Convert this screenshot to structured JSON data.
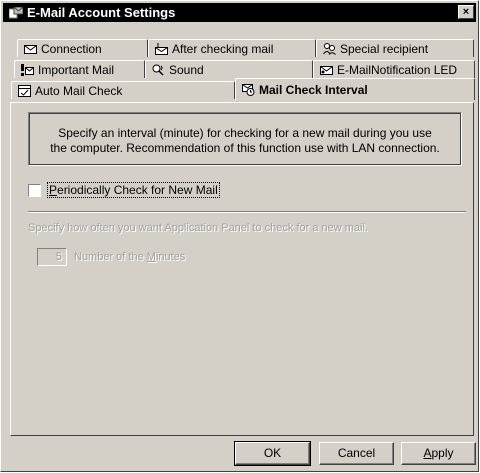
{
  "window": {
    "title": "E-Mail Account Settings",
    "close_glyph": "×"
  },
  "tabs": [
    {
      "label": "Connection",
      "icon": "envelope-icon"
    },
    {
      "label": "After checking mail",
      "icon": "mail-arrow-icon"
    },
    {
      "label": "Special recipient",
      "icon": "people-icon"
    },
    {
      "label": "Important Mail",
      "icon": "exclamation-mail-icon"
    },
    {
      "label": "Sound",
      "icon": "speaker-icon"
    },
    {
      "label": "E-MailNotification LED",
      "icon": "led-mail-icon"
    },
    {
      "label": "Auto Mail Check",
      "icon": "auto-check-icon"
    },
    {
      "label": "Mail Check Interval",
      "icon": "clock-mail-icon",
      "active": true
    }
  ],
  "content": {
    "info_line1": "Specify an interval (minute) for checking for a new mail during you use",
    "info_line2": "the computer. Recommendation of this function use with LAN connection.",
    "checkbox_label_pre": "",
    "checkbox_label_hot": "P",
    "checkbox_label_post": "eriodically Check for New Mail",
    "checkbox_checked": false,
    "hint": "Specify how often you want Application Panel to check for a new mail.",
    "minutes_value": "5",
    "minutes_label_pre": "Number of the ",
    "minutes_label_hot": "M",
    "minutes_label_post": "inutes"
  },
  "buttons": {
    "ok": "OK",
    "cancel": "Cancel",
    "apply_hot": "A",
    "apply_rest": "pply"
  }
}
